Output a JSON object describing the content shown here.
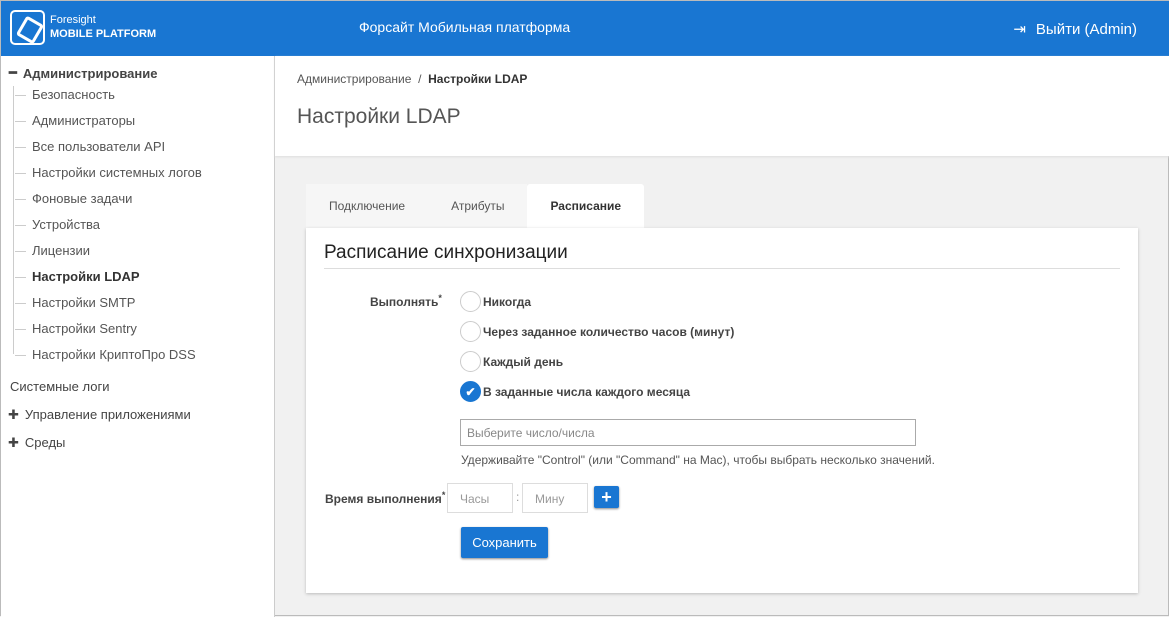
{
  "header": {
    "brand_top": "Foresight",
    "brand_bottom": "MOBILE PLATFORM",
    "title": "Форсайт Мобильная платформа",
    "logout": "Выйти (Admin)"
  },
  "sidebar": {
    "section": "Администрирование",
    "items": [
      "Безопасность",
      "Администраторы",
      "Все пользователи API",
      "Настройки системных логов",
      "Фоновые задачи",
      "Устройства",
      "Лицензии",
      "Настройки LDAP",
      "Настройки SMTP",
      "Настройки Sentry",
      "Настройки КриптоПро DSS"
    ],
    "active": "Настройки LDAP",
    "logs": "Системные логи",
    "apps": "Управление приложениями",
    "envs": "Среды"
  },
  "breadcrumb": {
    "parent": "Администрирование",
    "sep": "/",
    "current": "Настройки LDAP"
  },
  "page_title": "Настройки LDAP",
  "tabs": [
    "Подключение",
    "Атрибуты",
    "Расписание"
  ],
  "form": {
    "title": "Расписание синхронизации",
    "run_label": "Выполнять",
    "required": "*",
    "options": [
      "Никогда",
      "Через заданное количество часов (минут)",
      "Каждый день",
      "В заданные числа каждого месяца"
    ],
    "select_placeholder": "Выберите число/числа",
    "hint": "Удерживайте \"Control\" (или \"Command\" на Mac), чтобы выбрать несколько значений.",
    "time_label": "Время выполнения",
    "hours_placeholder": "Часы",
    "minutes_placeholder": "Мину",
    "colon": ":",
    "save": "Сохранить"
  },
  "colors": {
    "accent": "#1976d2"
  }
}
